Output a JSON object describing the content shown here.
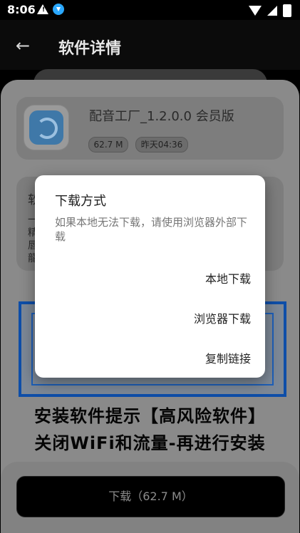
{
  "status_bar": {
    "time": "8:06"
  },
  "app_bar": {
    "title": "软件详情"
  },
  "app": {
    "name": "配音工厂_1.2.0.0 会员版",
    "size": "62.7 M",
    "date": "昨天04:36"
  },
  "info_fragments": [
    "软",
    "一",
    "精",
    "唇",
    "龍"
  ],
  "banner": {
    "line1": "安装软件提示【高风险软件】",
    "line2": "关闭WiFi和流量-再进行安装"
  },
  "download_button": "下载（62.7 M）",
  "dialog": {
    "title": "下载方式",
    "message": "如果本地无法下载，请使用浏览器外部下载",
    "options": [
      "本地下载",
      "浏览器下载",
      "复制链接"
    ]
  }
}
